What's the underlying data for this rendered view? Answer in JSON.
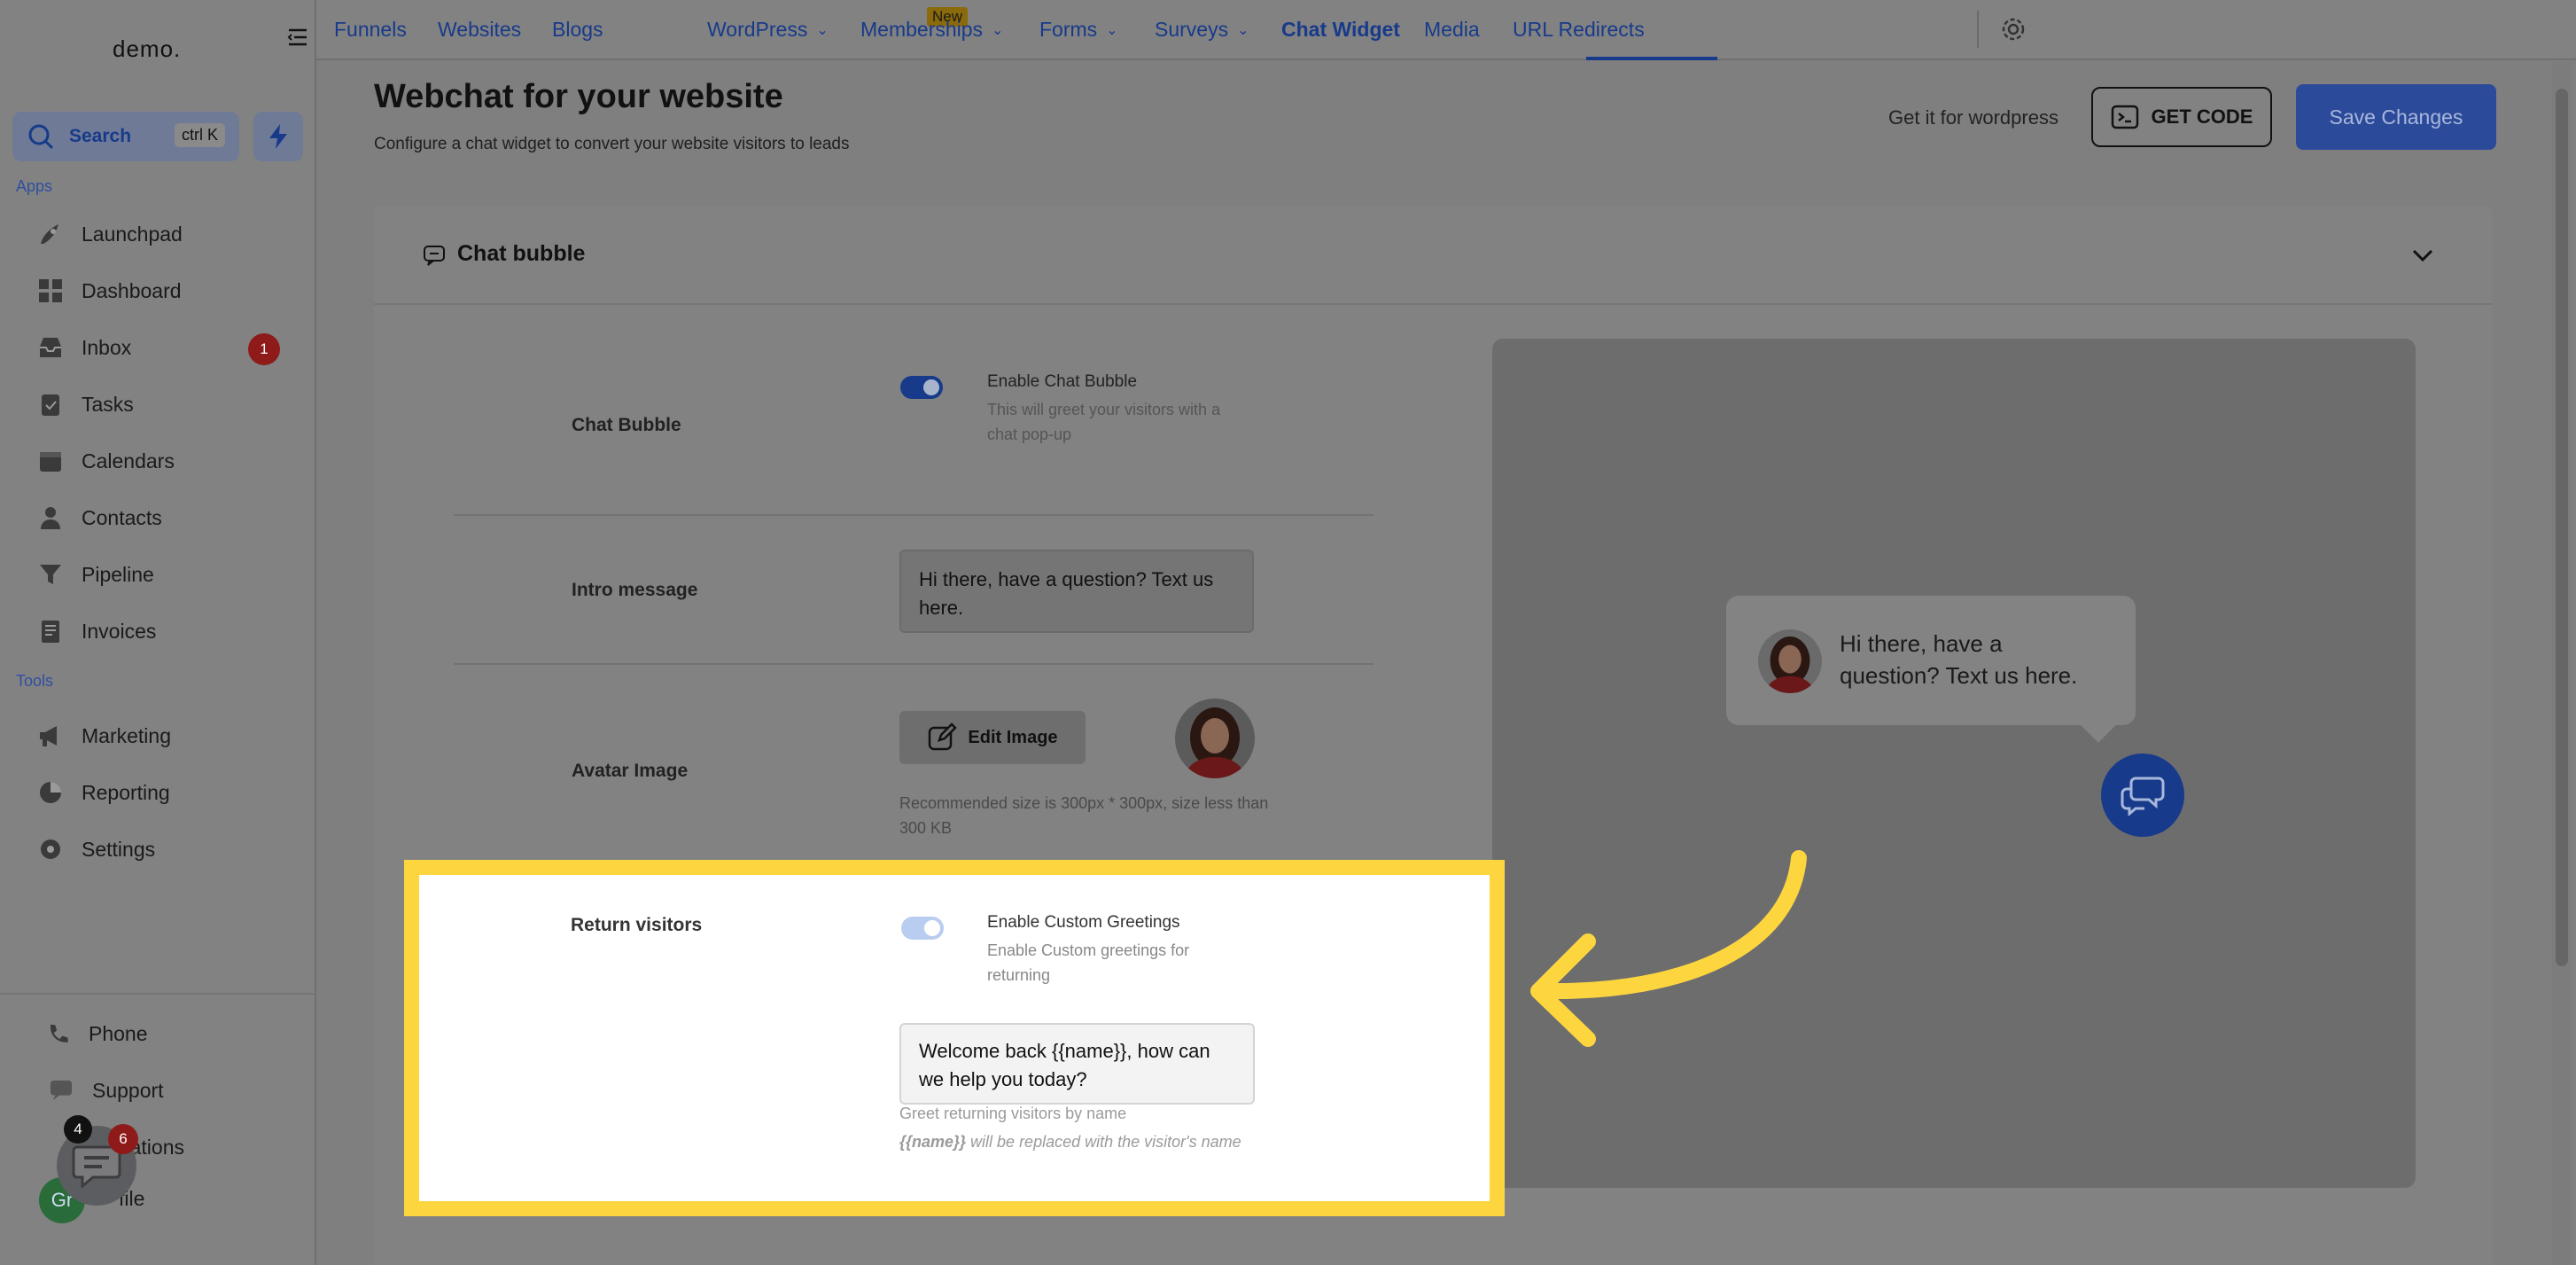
{
  "sidebar": {
    "logo": "demo.",
    "search": {
      "label": "Search",
      "shortcut": "ctrl K"
    },
    "apps_label": "Apps",
    "tools_label": "Tools",
    "apps": [
      {
        "label": "Launchpad",
        "icon": "rocket-icon"
      },
      {
        "label": "Dashboard",
        "icon": "grid-icon"
      },
      {
        "label": "Inbox",
        "icon": "inbox-icon",
        "badge": "1"
      },
      {
        "label": "Tasks",
        "icon": "clipboard-icon"
      },
      {
        "label": "Calendars",
        "icon": "calendar-icon"
      },
      {
        "label": "Contacts",
        "icon": "person-icon"
      },
      {
        "label": "Pipeline",
        "icon": "funnel-icon"
      },
      {
        "label": "Invoices",
        "icon": "invoice-icon"
      }
    ],
    "tools": [
      {
        "label": "Marketing",
        "icon": "megaphone-icon"
      },
      {
        "label": "Reporting",
        "icon": "pie-chart-icon"
      },
      {
        "label": "Settings",
        "icon": "gear-icon"
      }
    ],
    "bottom": [
      {
        "label": "Phone",
        "icon": "phone-icon"
      },
      {
        "label": "Support",
        "icon": "chat-icon"
      },
      {
        "label": "ications",
        "icon": "bell-icon"
      },
      {
        "label": "file",
        "icon": "avatar"
      }
    ],
    "chat_badge_black": "4",
    "chat_badge_red": "6",
    "avatar_initials": "Gr"
  },
  "topnav": {
    "items": [
      {
        "label": "Funnels"
      },
      {
        "label": "Websites"
      },
      {
        "label": "Blogs",
        "badge": "New"
      },
      {
        "label": "WordPress",
        "dropdown": true
      },
      {
        "label": "Memberships",
        "dropdown": true
      },
      {
        "label": "Forms",
        "dropdown": true
      },
      {
        "label": "Surveys",
        "dropdown": true
      },
      {
        "label": "Chat Widget",
        "active": true
      },
      {
        "label": "Media"
      },
      {
        "label": "URL Redirects"
      }
    ]
  },
  "header": {
    "title": "Webchat for your website",
    "subtitle": "Configure a chat widget to convert your website visitors to leads",
    "wordpress_link": "Get it for wordpress",
    "get_code": "GET CODE",
    "save": "Save Changes"
  },
  "card": {
    "title": "Chat bubble",
    "chat_bubble": {
      "label": "Chat Bubble",
      "toggle_title": "Enable Chat Bubble",
      "toggle_desc": "This will greet your visitors with a chat pop-up",
      "enabled": true
    },
    "intro": {
      "label": "Intro message",
      "value": "Hi there, have a question? Text us here."
    },
    "avatar": {
      "label": "Avatar Image",
      "button": "Edit Image",
      "hint": "Recommended size is 300px * 300px, size less than 300 KB"
    },
    "return_visitors": {
      "label": "Return visitors",
      "toggle_title": "Enable Custom Greetings",
      "toggle_desc": "Enable Custom greetings for returning",
      "enabled": true,
      "value": "Welcome back {{name}}, how can we help you today?",
      "hint1": "Greet returning visitors by name",
      "hint2_code": "{{name}}",
      "hint2_rest": " will be replaced with the visitor's name"
    }
  },
  "preview": {
    "bubble_text": "Hi there, have a question? Text us here."
  },
  "colors": {
    "accent": "#2c4a9a",
    "highlight": "#fcd53f",
    "badge_red": "#8e1a1a"
  }
}
